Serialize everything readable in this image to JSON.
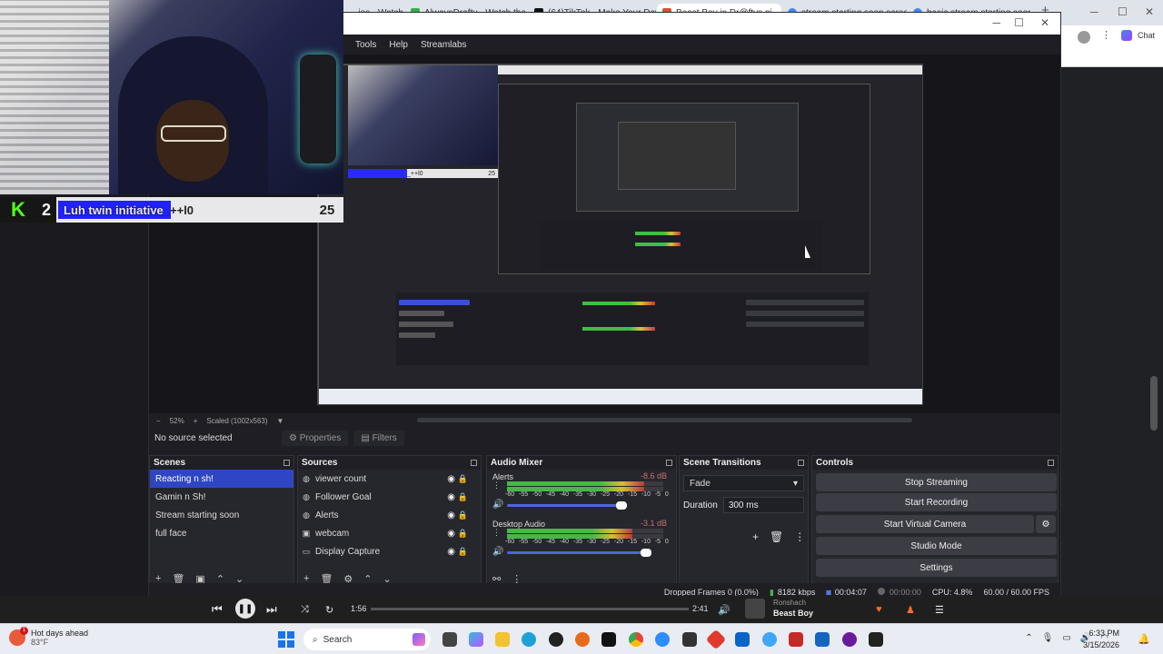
{
  "browser": {
    "tabs": [
      {
        "label": "...ies - Watch",
        "color": "#ffffff"
      },
      {
        "label": "AlwaysDrafty - Watch the V...",
        "color": "#35b04a"
      },
      {
        "label": "(64)TikTok - Make Your Day",
        "color": "#111111"
      },
      {
        "label": "Beast Boy in Dr@ftys pi...",
        "color": "#e14c2f"
      },
      {
        "label": "stream starting soon screen...",
        "color": "#4285f4"
      },
      {
        "label": "basic stream starting soon...",
        "color": "#4285f4"
      }
    ],
    "new_tab": "+",
    "chat_label": "Chat"
  },
  "obs": {
    "menu": [
      "Tools",
      "Help",
      "Streamlabs"
    ],
    "zoom": {
      "minus": "−",
      "percent": "52%",
      "plus": "+",
      "scale": "Scaled (1002x563)"
    },
    "props": {
      "no_source": "No source selected",
      "properties": "Properties",
      "filters": "Filters"
    },
    "scenes": {
      "title": "Scenes",
      "items": [
        "Reacting n sh!",
        "Gamin n Sh!",
        "Stream starting soon",
        "full face"
      ]
    },
    "sources": {
      "title": "Sources",
      "items": [
        {
          "label": "viewer count",
          "icon": "globe-icon"
        },
        {
          "label": "Follower Goal",
          "icon": "globe-icon"
        },
        {
          "label": "Alerts",
          "icon": "globe-icon"
        },
        {
          "label": "webcam",
          "icon": "camera-icon"
        },
        {
          "label": "Display Capture",
          "icon": "monitor-icon"
        }
      ]
    },
    "mixer": {
      "title": "Audio Mixer",
      "channels": [
        {
          "name": "Alerts",
          "db": "-8.6 dB",
          "level": 0.88,
          "volume": 0.7
        },
        {
          "name": "Desktop Audio",
          "db": "-3.1 dB",
          "level": 0.8,
          "volume": 0.85
        }
      ],
      "ticks": [
        "-60",
        "-55",
        "-50",
        "-45",
        "-40",
        "-35",
        "-30",
        "-25",
        "-20",
        "-15",
        "-10",
        "-5",
        "0"
      ]
    },
    "transitions": {
      "title": "Scene Transitions",
      "type": "Fade",
      "duration_label": "Duration",
      "duration": "300 ms"
    },
    "controls": {
      "title": "Controls",
      "buttons": [
        "Stop Streaming",
        "Start Recording",
        "Start Virtual Camera",
        "Studio Mode",
        "Settings"
      ]
    },
    "status": {
      "dropped": "Dropped Frames 0 (0.0%)",
      "kbps": "8182 kbps",
      "live_time": "00:04:07",
      "rec_time": "00:00:00",
      "cpu": "CPU: 4.8%",
      "fps": "60.00 / 60.00 FPS"
    }
  },
  "overlay": {
    "logo": "K",
    "count": "2",
    "goal_text": "Luh twin initiative",
    "goal_suffix": "_++l0",
    "goal_number": "25"
  },
  "nested": {
    "goal_number": "25",
    "goal_suffix": "_++l0"
  },
  "player": {
    "elapsed": "1:56",
    "total": "2:41",
    "progress": 0.0,
    "artist": "Ronshach",
    "track": "Beast Boy"
  },
  "taskbar": {
    "weather_title": "Hot days ahead",
    "weather_temp": "83°F",
    "weather_badge": "1",
    "search": "Search",
    "time": "6:33 PM",
    "date": "3/15/2026"
  }
}
